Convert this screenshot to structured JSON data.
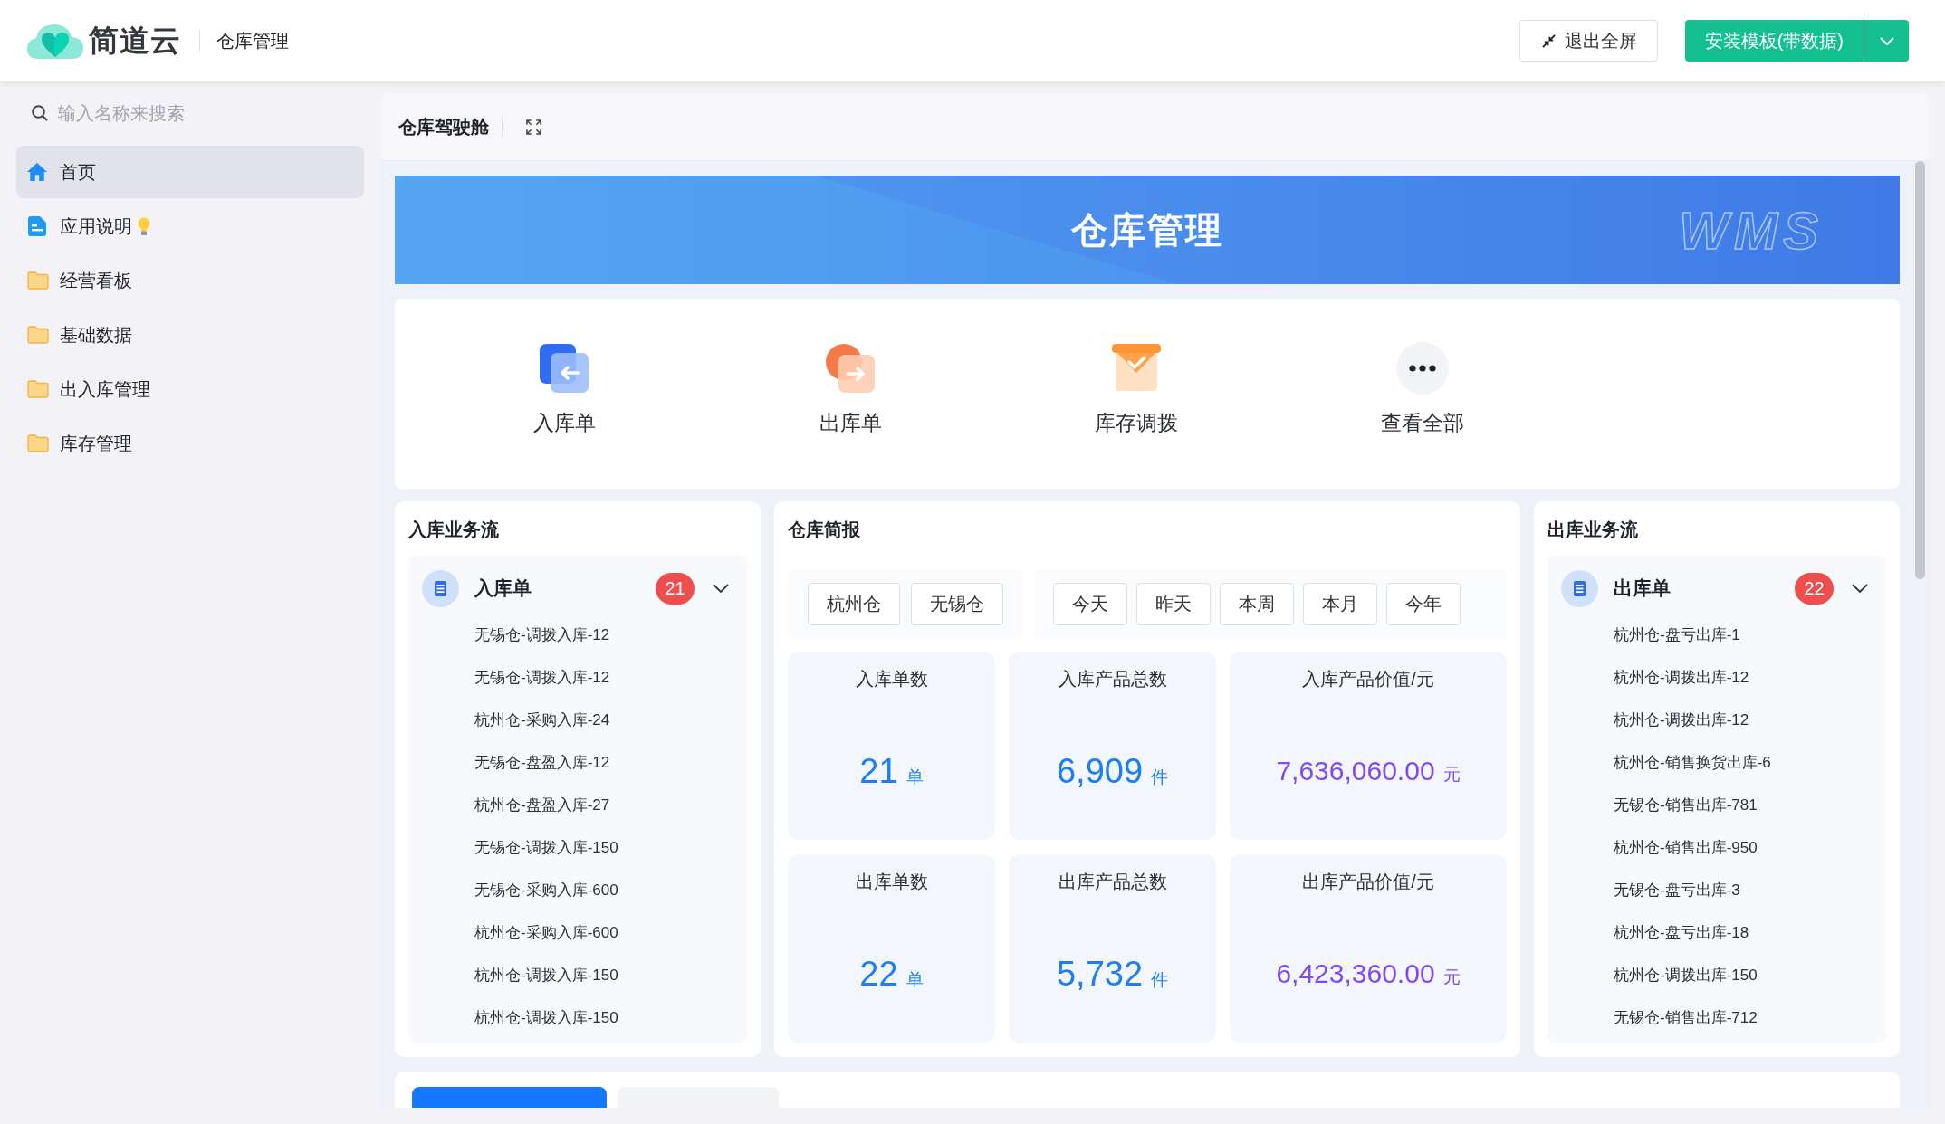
{
  "header": {
    "logo": "简道云",
    "app_name": "仓库管理",
    "exit_button": "退出全屏",
    "install_button": "安装模板(带数据)"
  },
  "sidebar": {
    "search": {
      "placeholder": "输入名称来搜索"
    },
    "items": [
      {
        "label": "首页",
        "kind": "home",
        "selected": true,
        "tip": false
      },
      {
        "label": "应用说明",
        "kind": "doc",
        "selected": false,
        "tip": true
      },
      {
        "label": "经营看板",
        "kind": "folder",
        "selected": false,
        "tip": false
      },
      {
        "label": "基础数据",
        "kind": "folder",
        "selected": false,
        "tip": false
      },
      {
        "label": "出入库管理",
        "kind": "folder",
        "selected": false,
        "tip": false
      },
      {
        "label": "库存管理",
        "kind": "folder",
        "selected": false,
        "tip": false
      }
    ]
  },
  "page": {
    "title": "仓库驾驶舱"
  },
  "banner": {
    "title": "仓库管理",
    "mark": "WMS"
  },
  "quick_actions": [
    {
      "label": "入库单",
      "kind": "inbound"
    },
    {
      "label": "出库单",
      "kind": "outbound"
    },
    {
      "label": "库存调拨",
      "kind": "transfer"
    },
    {
      "label": "查看全部",
      "kind": "more"
    }
  ],
  "inbound_flow": {
    "title": "入库业务流",
    "group": {
      "label": "入库单",
      "count": "21",
      "expanded": true,
      "items": [
        "无锡仓-调拨入库-12",
        "无锡仓-调拨入库-12",
        "杭州仓-采购入库-24",
        "无锡仓-盘盈入库-12",
        "杭州仓-盘盈入库-27",
        "无锡仓-调拨入库-150",
        "无锡仓-采购入库-600",
        "杭州仓-采购入库-600",
        "杭州仓-调拨入库-150",
        "杭州仓-调拨入库-150"
      ]
    }
  },
  "brief": {
    "title": "仓库简报",
    "warehouses": [
      {
        "label": "杭州仓",
        "selected": false
      },
      {
        "label": "无锡仓",
        "selected": false
      }
    ],
    "periods": [
      {
        "label": "今天",
        "selected": false
      },
      {
        "label": "昨天",
        "selected": false
      },
      {
        "label": "本周",
        "selected": false
      },
      {
        "label": "本月",
        "selected": false
      },
      {
        "label": "今年",
        "selected": false
      }
    ],
    "stats": [
      {
        "label": "入库单数",
        "value": "21",
        "unit": "单",
        "kind": "quantity"
      },
      {
        "label": "入库产品总数",
        "value": "6,909",
        "unit": "件",
        "kind": "quantity"
      },
      {
        "label": "入库产品价值/元",
        "value": "7,636,060.00",
        "unit": "元",
        "kind": "amount"
      },
      {
        "label": "出库单数",
        "value": "22",
        "unit": "单",
        "kind": "quantity"
      },
      {
        "label": "出库产品总数",
        "value": "5,732",
        "unit": "件",
        "kind": "quantity"
      },
      {
        "label": "出库产品价值/元",
        "value": "6,423,360.00",
        "unit": "元",
        "kind": "amount"
      }
    ]
  },
  "outbound_flow": {
    "title": "出库业务流",
    "group": {
      "label": "出库单",
      "count": "22",
      "expanded": true,
      "items": [
        "杭州仓-盘亏出库-1",
        "杭州仓-调拨出库-12",
        "杭州仓-调拨出库-12",
        "杭州仓-销售换货出库-6",
        "无锡仓-销售出库-781",
        "杭州仓-销售出库-950",
        "无锡仓-盘亏出库-3",
        "杭州仓-盘亏出库-18",
        "杭州仓-调拨出库-150",
        "无锡仓-销售出库-712"
      ]
    }
  },
  "bottom_tabs": [
    {
      "selected": true
    },
    {
      "selected": false
    }
  ]
}
